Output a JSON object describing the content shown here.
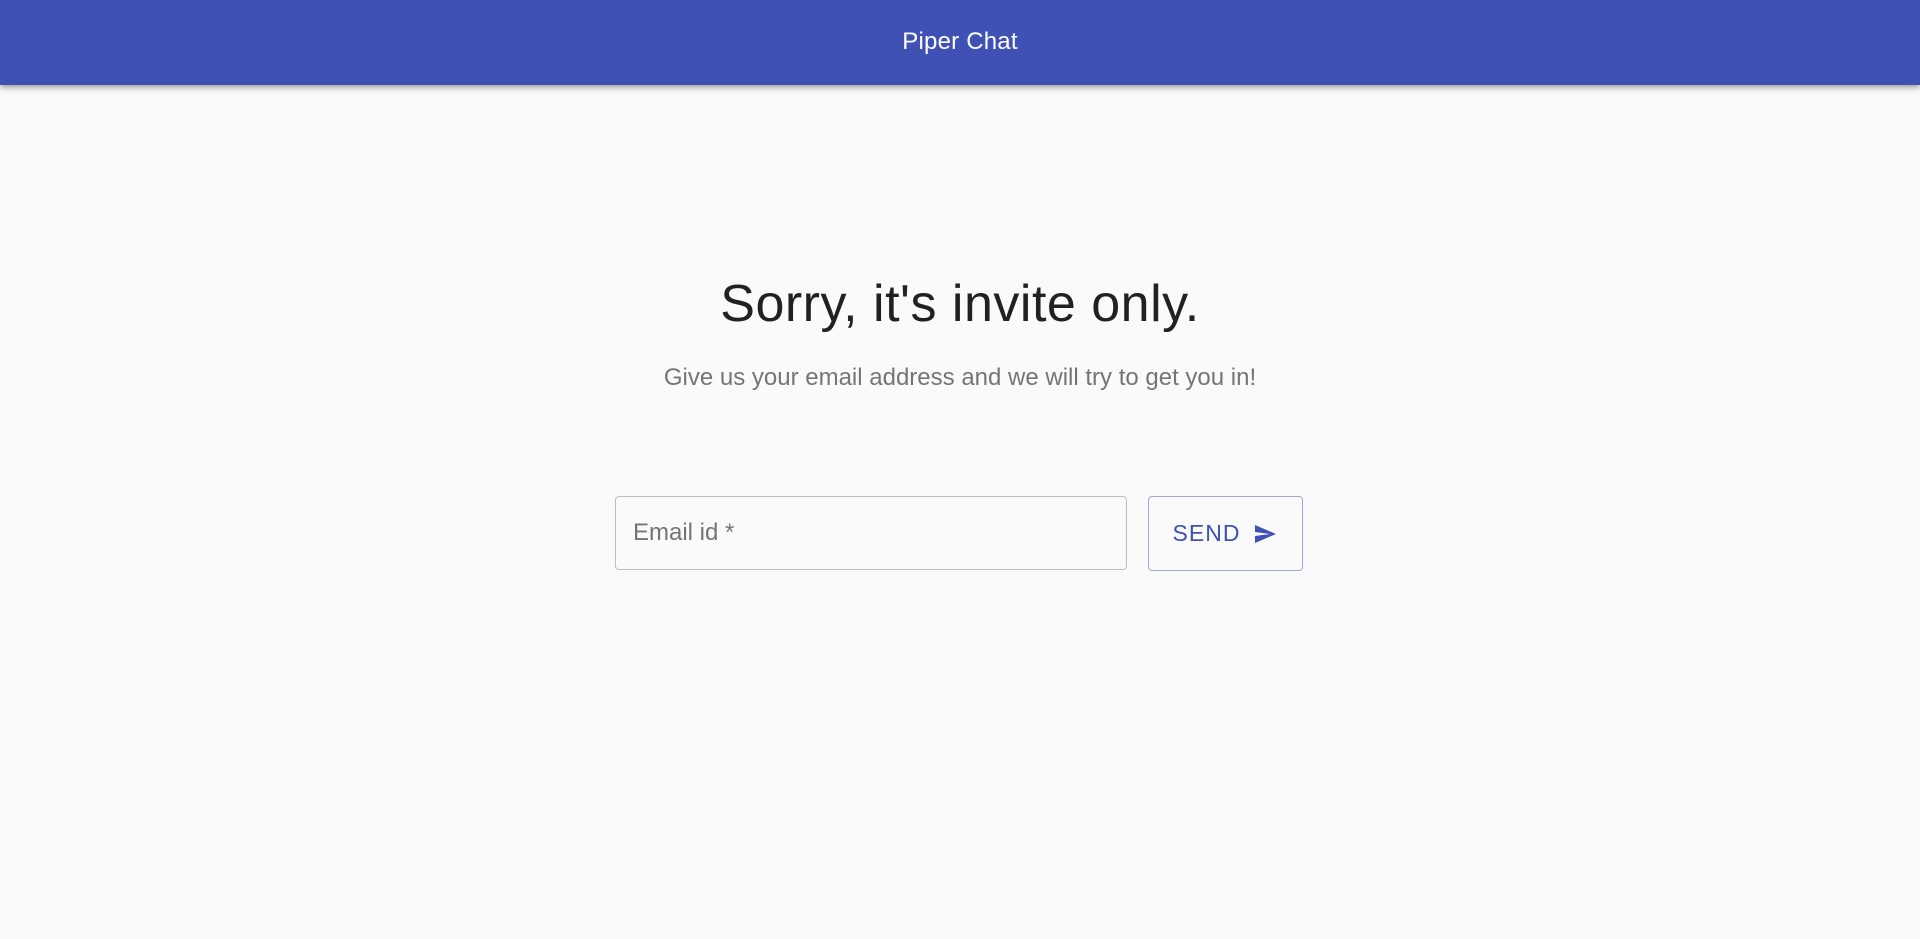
{
  "app": {
    "title": "Piper Chat",
    "brand_color": "#3f51b5"
  },
  "main": {
    "headline": "Sorry, it's invite only.",
    "subtitle": "Give us your email address and we will try to get you in!"
  },
  "form": {
    "email": {
      "placeholder": "Email id *",
      "value": ""
    },
    "send_label": "SEND",
    "send_icon": "send-icon"
  }
}
